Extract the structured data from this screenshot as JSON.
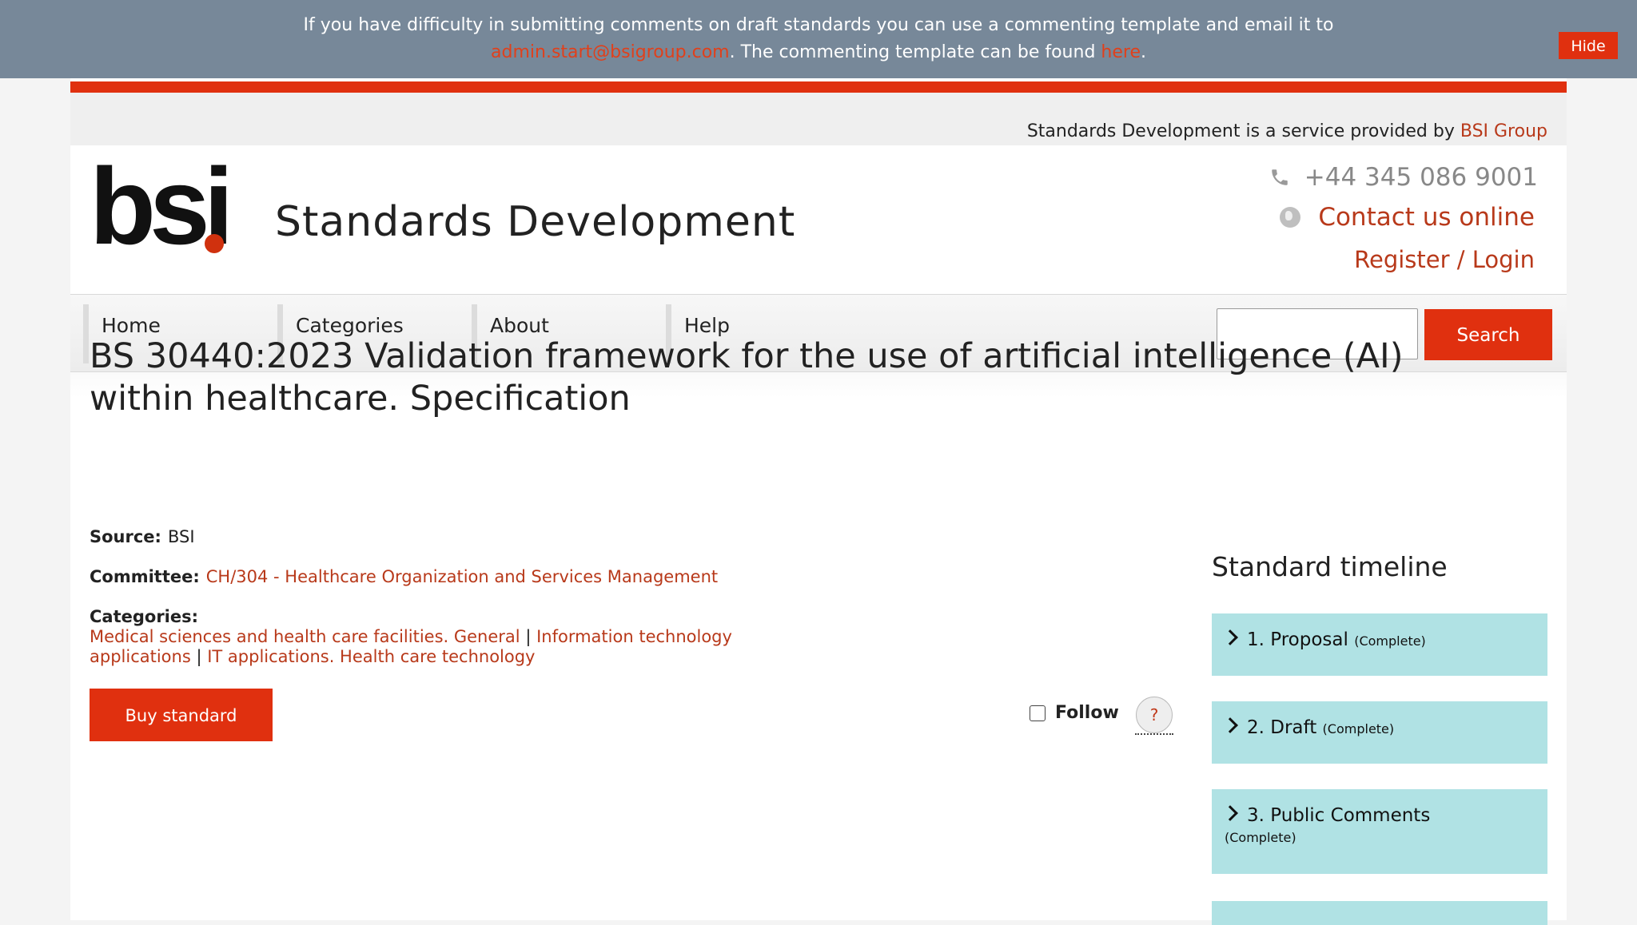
{
  "banner": {
    "line1": "If you have difficulty in submitting comments on draft standards you can use a commenting template and email it to",
    "email": "admin.start@bsigroup.com",
    "line2_mid": ". The commenting template can be found ",
    "here_link": "here",
    "line2_end": ".",
    "hide_label": "Hide"
  },
  "service": {
    "text": "Standards Development is a service provided by ",
    "link": "BSI Group"
  },
  "header": {
    "logo_text": "bsi",
    "site_title": "Standards Development",
    "phone": "+44 345 086 9001",
    "contact": "Contact us online",
    "login": "Register / Login"
  },
  "nav": {
    "items": [
      "Home",
      "Categories",
      "About",
      "Help"
    ],
    "search_label": "Search",
    "search_value": ""
  },
  "standard": {
    "title": "BS 30440:2023 Validation framework for the use of artificial intelligence (AI) within healthcare. Specification",
    "source_label": "Source:",
    "source_value": "BSI",
    "committee_label": "Committee:",
    "committee_value": "CH/304 - Healthcare Organization and Services Management",
    "categories_label": "Categories:",
    "categories": [
      "Medical sciences and health care facilities. General",
      "Information technology applications",
      "IT applications. Health care technology"
    ],
    "separator": "|",
    "buy_label": "Buy standard",
    "follow_label": "Follow",
    "help_symbol": "?"
  },
  "timeline": {
    "heading": "Standard timeline",
    "items": [
      {
        "label": "1. Proposal",
        "status": "(Complete)"
      },
      {
        "label": "2. Draft",
        "status": "(Complete)"
      },
      {
        "label": "3. Public Comments",
        "status": "(Complete)"
      }
    ]
  },
  "colors": {
    "accent": "#e0300f",
    "link": "#b8391a",
    "banner_bg": "#778899",
    "timeline_bg": "#b0e2e4"
  }
}
